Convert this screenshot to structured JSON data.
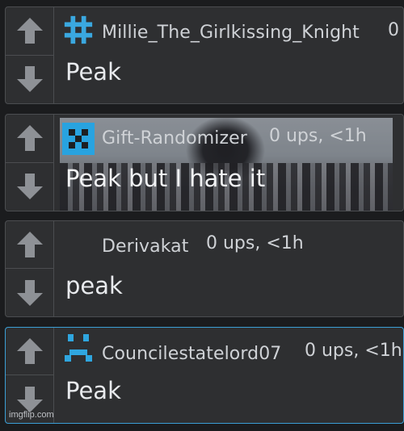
{
  "comments": [
    {
      "username": "Millie_The_Girlkissing_Knight",
      "meta": "0",
      "text": "Peak",
      "avatar_icon": "hashtag-icon",
      "avatar_color": "#3aa8e0"
    },
    {
      "username": "Gift-Randomizer",
      "meta": "0 ups, <1h",
      "text": "Peak but I hate it",
      "avatar_icon": "pixel-pattern-icon",
      "avatar_color": "#28a3e0"
    },
    {
      "username": "Derivakat",
      "meta": "0 ups, <1h",
      "text": "peak",
      "avatar_icon": "",
      "avatar_color": ""
    },
    {
      "username": "Councilestatelord07",
      "meta": "0 ups, <1h",
      "text": "Peak",
      "avatar_icon": "sad-face-icon",
      "avatar_color": "#2fa6df"
    }
  ],
  "watermark": "imgflip.com",
  "colors": {
    "background": "#1b1c1e",
    "card": "#2e2f31",
    "accent": "#3b9fd6",
    "arrow": "#8e9196"
  }
}
